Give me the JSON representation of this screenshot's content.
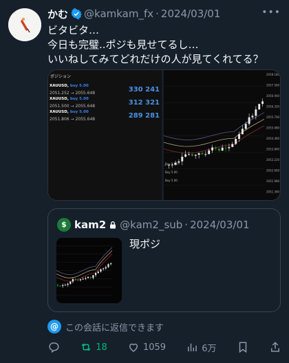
{
  "author": {
    "name": "かむ",
    "handle": "@kamkam_fx",
    "separator": "·",
    "date": "2024/03/01",
    "more_label": "•••"
  },
  "tweet": {
    "lines": [
      "ビタビタ…",
      "今日も完璧..ポジも見せてるし…",
      "いいねしてみてどれだけの人が見てくれてる？"
    ]
  },
  "media": {
    "positions_title": "ポジション",
    "positions": [
      {
        "symbol": "XAUUSD,",
        "side": "buy 5.00",
        "range": "2051.252 → 2055.648",
        "profit": "330 241"
      },
      {
        "symbol": "XAUUSD,",
        "side": "buy 5.00",
        "range": "2051.500 → 2055.648",
        "profit": "312 321"
      },
      {
        "symbol": "XAUUSD,",
        "side": "buy 5.00",
        "range": "2051.806 → 2055.648",
        "profit": "289 281"
      }
    ],
    "price_axis": [
      "2058.180",
      "2057.560",
      "2056.940",
      "2056.320",
      "2055.700",
      "2055.080",
      "2054.460",
      "2053.840",
      "2053.220",
      "2052.600",
      "2051.980",
      "2051.360"
    ],
    "chart_labels": [
      "Buy 5.00",
      "Buy 5.00",
      "Buy 5.00"
    ]
  },
  "quote": {
    "avatar_letter": "$",
    "name": "kam2",
    "handle": "@kam2_sub",
    "separator": "·",
    "date": "2024/03/01",
    "text": "現ポジ"
  },
  "reply_note": {
    "text": "この会話に返信できます"
  },
  "actions": {
    "retweets": "18",
    "likes": "1059",
    "views": "6万"
  },
  "colors": {
    "background": "#15202b",
    "text": "#f7f9f9",
    "secondary": "#8b98a5",
    "accent": "#1d9bf0",
    "retweet": "#00ba7c"
  }
}
